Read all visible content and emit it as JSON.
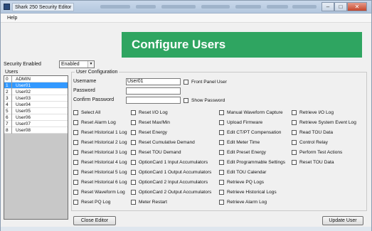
{
  "window": {
    "title": "Shark 250 Security Editor"
  },
  "menu": {
    "help": "Help"
  },
  "banner": {
    "title": "Configure Users"
  },
  "security": {
    "label": "Security Enabled",
    "value": "Enabled"
  },
  "users": {
    "label": "Users",
    "list": [
      {
        "num": "0",
        "name": "ADMIN",
        "selected": false
      },
      {
        "num": "1",
        "name": "User01",
        "selected": true
      },
      {
        "num": "2",
        "name": "User02",
        "selected": false
      },
      {
        "num": "3",
        "name": "User03",
        "selected": false
      },
      {
        "num": "4",
        "name": "User04",
        "selected": false
      },
      {
        "num": "5",
        "name": "User05",
        "selected": false
      },
      {
        "num": "6",
        "name": "User06",
        "selected": false
      },
      {
        "num": "7",
        "name": "User07",
        "selected": false
      },
      {
        "num": "8",
        "name": "User08",
        "selected": false
      }
    ]
  },
  "config": {
    "legend": "User Configuration",
    "username_label": "Username",
    "username_value": "User01",
    "password_label": "Password",
    "password_value": "",
    "confirm_label": "Confirm Password",
    "confirm_value": "",
    "front_panel_user": "Front Panel User",
    "show_password": "Show Password"
  },
  "permissions": {
    "col1": [
      "Select All",
      "Reset Alarm Log",
      "Reset Historical 1 Log",
      "Reset Historical 2 Log",
      "Reset Historical 3 Log",
      "Reset Historical 4 Log",
      "Reset Historical 5 Log",
      "Reset Historical 6 Log",
      "Reset Waveform Log",
      "Reset PQ Log"
    ],
    "col2": [
      "Reset I/O Log",
      "Reset Max/Min",
      "Reset Energy",
      "Reset Cumulative Demand",
      "Reset TOU Demand",
      "OptionCard 1 Input Accumulators",
      "OptionCard 1 Output Accumulators",
      "OptionCard 2 Input Accumulators",
      "OptionCard 2 Output Accumulators",
      "Meter Restart"
    ],
    "col3": [
      "Manual Waveform Capture",
      "Upload Firmware",
      "Edit CT/PT Compensation",
      "Edit Meter Time",
      "Edit Preset Energy",
      "Edit Programmable Settings",
      "Edit TOU Calendar",
      "Retrieve PQ Logs",
      "Retrieve Historical Logs",
      "Retrieve Alarm Log"
    ],
    "col4": [
      "Retrieve I/O Log",
      "Retrieve System Event Log",
      "Read TOU Data",
      "Control Relay",
      "Perform Test Actions",
      "Reset TOU Data"
    ]
  },
  "buttons": {
    "close_editor": "Close Editor",
    "update_user": "Update User"
  }
}
